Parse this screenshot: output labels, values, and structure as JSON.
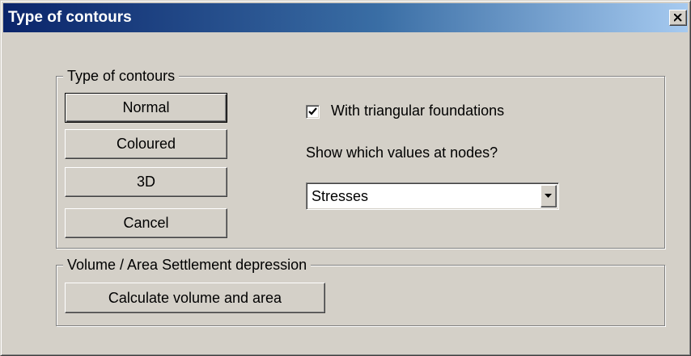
{
  "window": {
    "title": "Type of contours",
    "close_icon": "close-icon"
  },
  "contours_group": {
    "label": "Type of contours",
    "buttons": {
      "normal": "Normal",
      "coloured": "Coloured",
      "three_d": "3D",
      "cancel": "Cancel"
    },
    "triangular_checkbox": {
      "label": "With triangular foundations",
      "checked": true
    },
    "node_values_label": "Show which values at nodes?",
    "node_values_select": {
      "value": "Stresses",
      "arrow_icon": "chevron-down-icon"
    }
  },
  "volume_group": {
    "label": "Volume / Area Settlement depression",
    "calculate_button": "Calculate volume and area"
  },
  "colors": {
    "face": "#d4d0c8",
    "title_gradient_start": "#0a246a",
    "title_gradient_end": "#a6caf0"
  }
}
